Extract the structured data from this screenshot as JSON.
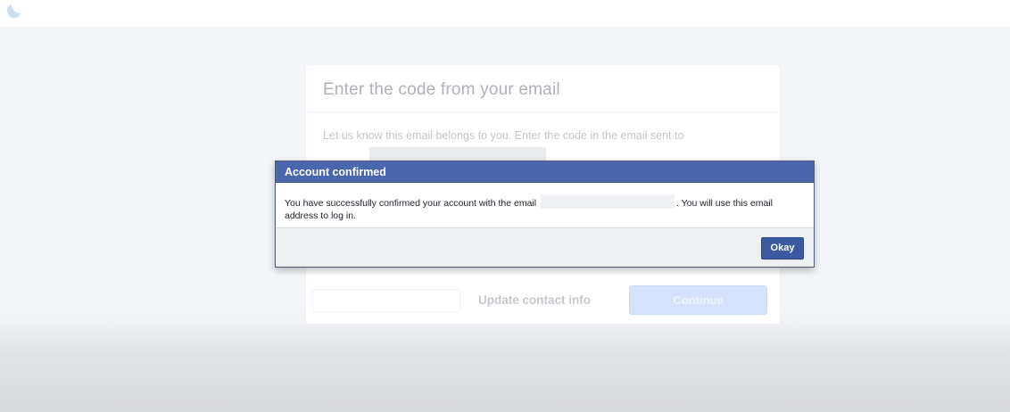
{
  "page": {
    "form": {
      "title": "Enter the code from your email",
      "description": "Let us know this email belongs to you. Enter the code in the email sent to",
      "update_contact_label": "Update contact info",
      "continue_label": "Continue"
    }
  },
  "dialog": {
    "title": "Account confirmed",
    "message_before_email": "You have successfully confirmed your account with the email",
    "message_after_email": ". You will use this email address to log in.",
    "okay_label": "Okay"
  },
  "colors": {
    "header_blue": "#4a67ad",
    "button_blue": "#3b5a9f",
    "continue_disabled": "#d4e3fb"
  }
}
